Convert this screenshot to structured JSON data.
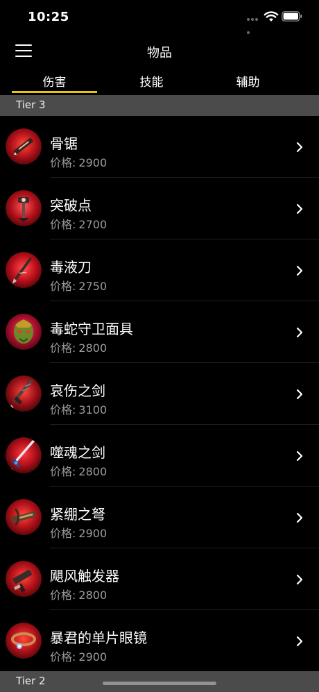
{
  "status": {
    "time": "10:25"
  },
  "nav": {
    "title": "物品"
  },
  "tabs": [
    {
      "label": "伤害",
      "selected": true
    },
    {
      "label": "技能",
      "selected": false
    },
    {
      "label": "辅助",
      "selected": false
    }
  ],
  "sections": [
    {
      "title": "Tier 3"
    },
    {
      "title": "Tier 2"
    }
  ],
  "price_label": "价格:",
  "items": [
    {
      "name": "骨锯",
      "price": "2900",
      "icon": "bone-saw-icon"
    },
    {
      "name": "突破点",
      "price": "2700",
      "icon": "breach-point-icon"
    },
    {
      "name": "毒液刀",
      "price": "2750",
      "icon": "venom-blade-icon"
    },
    {
      "name": "毒蛇守卫面具",
      "price": "2800",
      "icon": "serpent-guard-mask-icon"
    },
    {
      "name": "哀伤之剑",
      "price": "3100",
      "icon": "sorrow-sword-icon"
    },
    {
      "name": "噬魂之剑",
      "price": "2800",
      "icon": "soul-eater-sword-icon"
    },
    {
      "name": "紧绷之弩",
      "price": "2900",
      "icon": "tense-crossbow-icon"
    },
    {
      "name": "飓风触发器",
      "price": "2800",
      "icon": "hurricane-trigger-icon"
    },
    {
      "name": "暴君的单片眼镜",
      "price": "2900",
      "icon": "tyrant-monocle-icon"
    }
  ],
  "colors": {
    "accent": "#f3c300",
    "section_bg": "#4b4b4b",
    "icon_ring": "#c81e28"
  }
}
